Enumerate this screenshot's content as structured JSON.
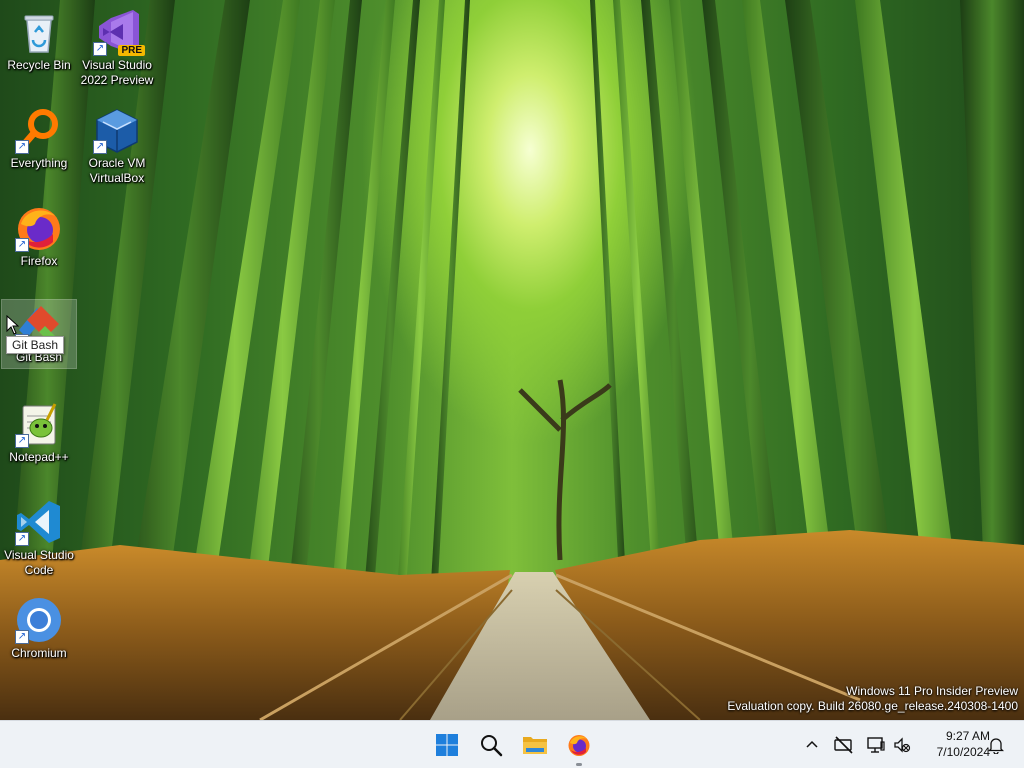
{
  "desktop": {
    "icons": [
      {
        "name": "recycle-bin",
        "label": "Recycle Bin",
        "icon": "recycle-bin-icon"
      },
      {
        "name": "visual-studio-2022-preview",
        "label": "Visual Studio 2022 Preview",
        "icon": "visual-studio-preview-icon",
        "badge": "PRE"
      },
      {
        "name": "everything",
        "label": "Everything",
        "icon": "everything-search-icon"
      },
      {
        "name": "oracle-vm-virtualbox",
        "label": "Oracle VM VirtualBox",
        "icon": "virtualbox-icon"
      },
      {
        "name": "firefox",
        "label": "Firefox",
        "icon": "firefox-icon"
      },
      {
        "name": "git-bash",
        "label": "Git Bash",
        "icon": "git-bash-icon"
      },
      {
        "name": "notepad-plus-plus",
        "label": "Notepad++",
        "icon": "notepad-plus-plus-icon"
      },
      {
        "name": "visual-studio-code",
        "label": "Visual Studio Code",
        "icon": "vscode-icon"
      },
      {
        "name": "chromium",
        "label": "Chromium",
        "icon": "chromium-icon"
      }
    ],
    "tooltip": "Git Bash"
  },
  "watermark": {
    "line1": "Windows 11 Pro Insider Preview",
    "line2": "Evaluation copy. Build 26080.ge_release.240308-1400"
  },
  "taskbar": {
    "pinned": [
      {
        "name": "start-button",
        "icon": "windows-start-icon"
      },
      {
        "name": "search-button",
        "icon": "search-icon"
      },
      {
        "name": "file-explorer-button",
        "icon": "file-explorer-icon"
      },
      {
        "name": "firefox-taskbar-button",
        "icon": "firefox-icon"
      }
    ],
    "tray": {
      "chevron": "chevron-up-icon",
      "network": "network-disconnected-icon",
      "display": "display-icon",
      "volume": "volume-muted-icon",
      "notifications": "bell-icon"
    },
    "clock": {
      "time": "9:27 AM",
      "date": "7/10/2024"
    }
  },
  "colors": {
    "taskbar": "#eef2f6",
    "windows_blue": "#1e7fdc",
    "explorer_yellow": "#f5c242",
    "firefox_orange": "#ff7a1a",
    "vscode_blue": "#1f8ad2"
  }
}
